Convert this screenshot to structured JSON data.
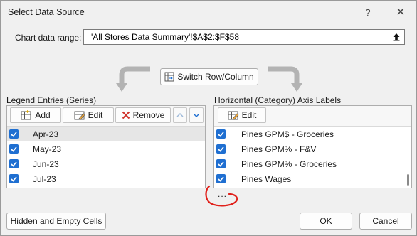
{
  "window": {
    "title": "Select Data Source",
    "help_glyph": "?",
    "close_glyph": "✕"
  },
  "range": {
    "label": "Chart data range:",
    "value": "='All Stores Data Summary'!$A$2:$F$58"
  },
  "switch_button": {
    "label": "Switch Row/Column"
  },
  "legend": {
    "label": "Legend Entries (Series)",
    "add_label": "Add",
    "edit_label": "Edit",
    "remove_label": "Remove",
    "items": [
      {
        "label": "Apr-23",
        "checked": true,
        "selected": true
      },
      {
        "label": "May-23",
        "checked": true,
        "selected": false
      },
      {
        "label": "Jun-23",
        "checked": true,
        "selected": false
      },
      {
        "label": "Jul-23",
        "checked": true,
        "selected": false
      }
    ]
  },
  "axis": {
    "label": "Horizontal (Category) Axis Labels",
    "edit_label": "Edit",
    "items": [
      {
        "label": "Pines GPM$ - Groceries",
        "checked": true
      },
      {
        "label": "Pines GPM% - F&V",
        "checked": true
      },
      {
        "label": "Pines GPM% - Groceries",
        "checked": true
      },
      {
        "label": "Pines Wages",
        "checked": true
      }
    ],
    "more": "..."
  },
  "footer": {
    "hidden_cells_label": "Hidden and Empty Cells",
    "ok_label": "OK",
    "cancel_label": "Cancel"
  },
  "colors": {
    "checkbox": "#1f6fd1",
    "annotation": "#e0211b",
    "arrow_gray": "#b3b3b3"
  }
}
